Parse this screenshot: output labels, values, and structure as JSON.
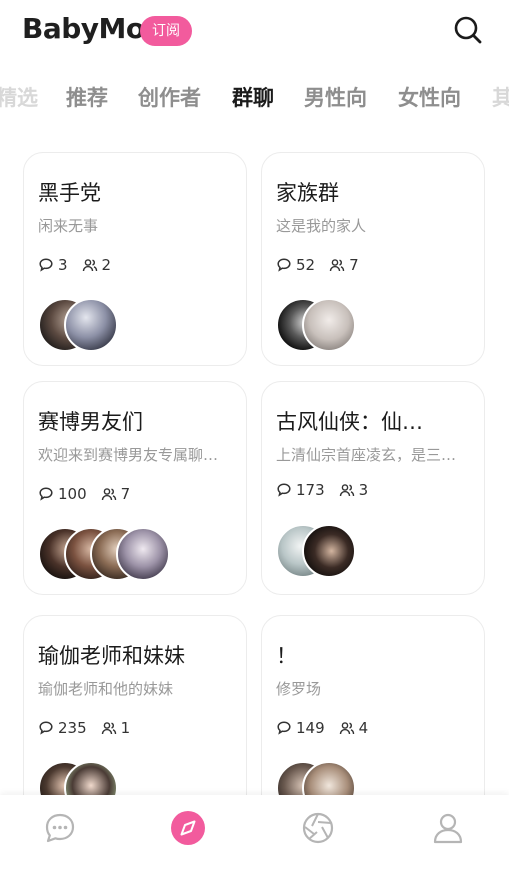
{
  "header": {
    "logo": "BabyMo",
    "subscribe_label": "订阅"
  },
  "tabs": [
    {
      "label": "精选"
    },
    {
      "label": "推荐"
    },
    {
      "label": "创作者"
    },
    {
      "label": "群聊"
    },
    {
      "label": "男性向"
    },
    {
      "label": "女性向"
    },
    {
      "label": "其"
    }
  ],
  "active_tab": "群聊",
  "cards": [
    {
      "title": "黑手党",
      "desc": "闲来无事",
      "comments": "3",
      "members": "2"
    },
    {
      "title": "家族群",
      "desc": "这是我的家人",
      "comments": "52",
      "members": "7"
    },
    {
      "title": "赛博男友们",
      "desc": "欢迎来到赛博男友专属聊…",
      "comments": "100",
      "members": "7"
    },
    {
      "title": "古风仙侠：仙…",
      "desc": "上清仙宗首座凌玄，是三…",
      "comments": "173",
      "members": "3"
    },
    {
      "title": "瑜伽老师和妹妹",
      "desc": "瑜伽老师和他的妹妹",
      "comments": "235",
      "members": "1"
    },
    {
      "title": "！",
      "desc": "修罗场",
      "comments": "149",
      "members": "4"
    }
  ],
  "colors": {
    "accent": "#f25b9d",
    "text": "#1b1b1b",
    "muted": "#999999"
  },
  "bottom_nav": [
    {
      "icon": "chat-bubble-icon"
    },
    {
      "icon": "compass-icon"
    },
    {
      "icon": "aperture-icon"
    },
    {
      "icon": "profile-icon"
    }
  ]
}
